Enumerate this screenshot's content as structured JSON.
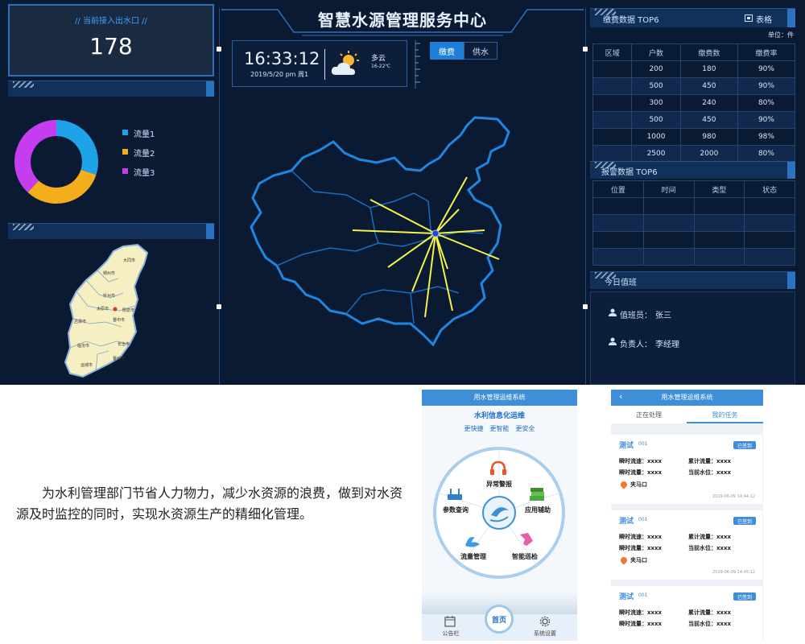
{
  "dashboard": {
    "title": "智慧水源管理服务中心",
    "outlet_label": "// 当前接入出水口 //",
    "outlet_count": "178",
    "time": "16:33:12",
    "date": "2019/5/20  pm  周1",
    "weather": {
      "condition": "多云",
      "temp_range": "16-22℃"
    },
    "tabs": [
      {
        "label": "缴费",
        "active": true
      },
      {
        "label": "供水",
        "active": false
      }
    ],
    "donut": {
      "legend": [
        "流量1",
        "流量2",
        "流量3"
      ],
      "colors": [
        "#1fa3e8",
        "#f2ae1b",
        "#c43ef0"
      ],
      "values": [
        30,
        32,
        38
      ]
    },
    "province_labels": [
      "大同市",
      "朔州市",
      "忻州市",
      "太原市",
      "阳泉市",
      "吕梁市",
      "晋中市",
      "长治市",
      "临汾市",
      "晋城市",
      "运城市"
    ],
    "payment": {
      "title": "缴费数据 TOP6",
      "toggle_label": "表格",
      "unit": "单位：件",
      "headers": [
        "区域",
        "户数",
        "缴费数",
        "缴费率"
      ],
      "rows": [
        [
          "",
          "200",
          "180",
          "90%"
        ],
        [
          "",
          "500",
          "450",
          "90%"
        ],
        [
          "",
          "300",
          "240",
          "80%"
        ],
        [
          "",
          "500",
          "450",
          "90%"
        ],
        [
          "",
          "1000",
          "980",
          "98%"
        ],
        [
          "",
          "2500",
          "2000",
          "80%"
        ]
      ]
    },
    "alarm": {
      "title": "报警数据 TOP6",
      "headers": [
        "位置",
        "时间",
        "类型",
        "状态"
      ],
      "rows": [
        [
          "",
          "",
          "",
          ""
        ],
        [
          "",
          "",
          "",
          ""
        ],
        [
          "",
          "",
          "",
          ""
        ],
        [
          "",
          "",
          "",
          ""
        ]
      ]
    },
    "duty": {
      "title": "今日值班",
      "officer_label": "值班员：",
      "officer": "张三",
      "manager_label": "负责人：",
      "manager": "李经理"
    }
  },
  "description": "为水利管理部门节省人力物力，减少水资源的浪费，做到对水资源及时监控的同时，实现水资源生产的精细化管理。",
  "phone1": {
    "app_title": "用水管理运维系统",
    "subtitle": "水利信息化运维",
    "slogans": [
      "更快捷",
      "更智能",
      "更安全"
    ],
    "menu": [
      "异常警报",
      "应用辅助",
      "智能巡检",
      "流量管理",
      "参数查询"
    ],
    "center_button": "首页",
    "bottom": [
      "公告栏",
      "系统设置"
    ]
  },
  "phone2": {
    "app_title": "用水管理运维系统",
    "tabs": [
      "正在处理",
      "我的任务"
    ],
    "tasks": [
      {
        "title": "测试",
        "code": "001",
        "badge": "已签到",
        "flow_rate": "瞬时流速：xxxx",
        "total_flow": "累计流量：xxxx",
        "instant_flow": "瞬时流量：xxxx",
        "water_level": "当前水位：xxxx",
        "location": "夹马口",
        "time": "2019-06-09 14:44:12"
      },
      {
        "title": "测试",
        "code": "001",
        "badge": "已签到",
        "flow_rate": "瞬时流速：xxxx",
        "total_flow": "累计流量：xxxx",
        "instant_flow": "瞬时流量：xxxx",
        "water_level": "当前水位：xxxx",
        "location": "夹马口",
        "time": "2019-06-09 14:45:12"
      },
      {
        "title": "测试",
        "code": "001",
        "badge": "已签到",
        "flow_rate": "瞬时流速：xxxx",
        "total_flow": "累计流量：xxxx",
        "instant_flow": "瞬时流量：xxxx",
        "water_level": "当前水位：xxxx",
        "location": "",
        "time": ""
      }
    ]
  }
}
